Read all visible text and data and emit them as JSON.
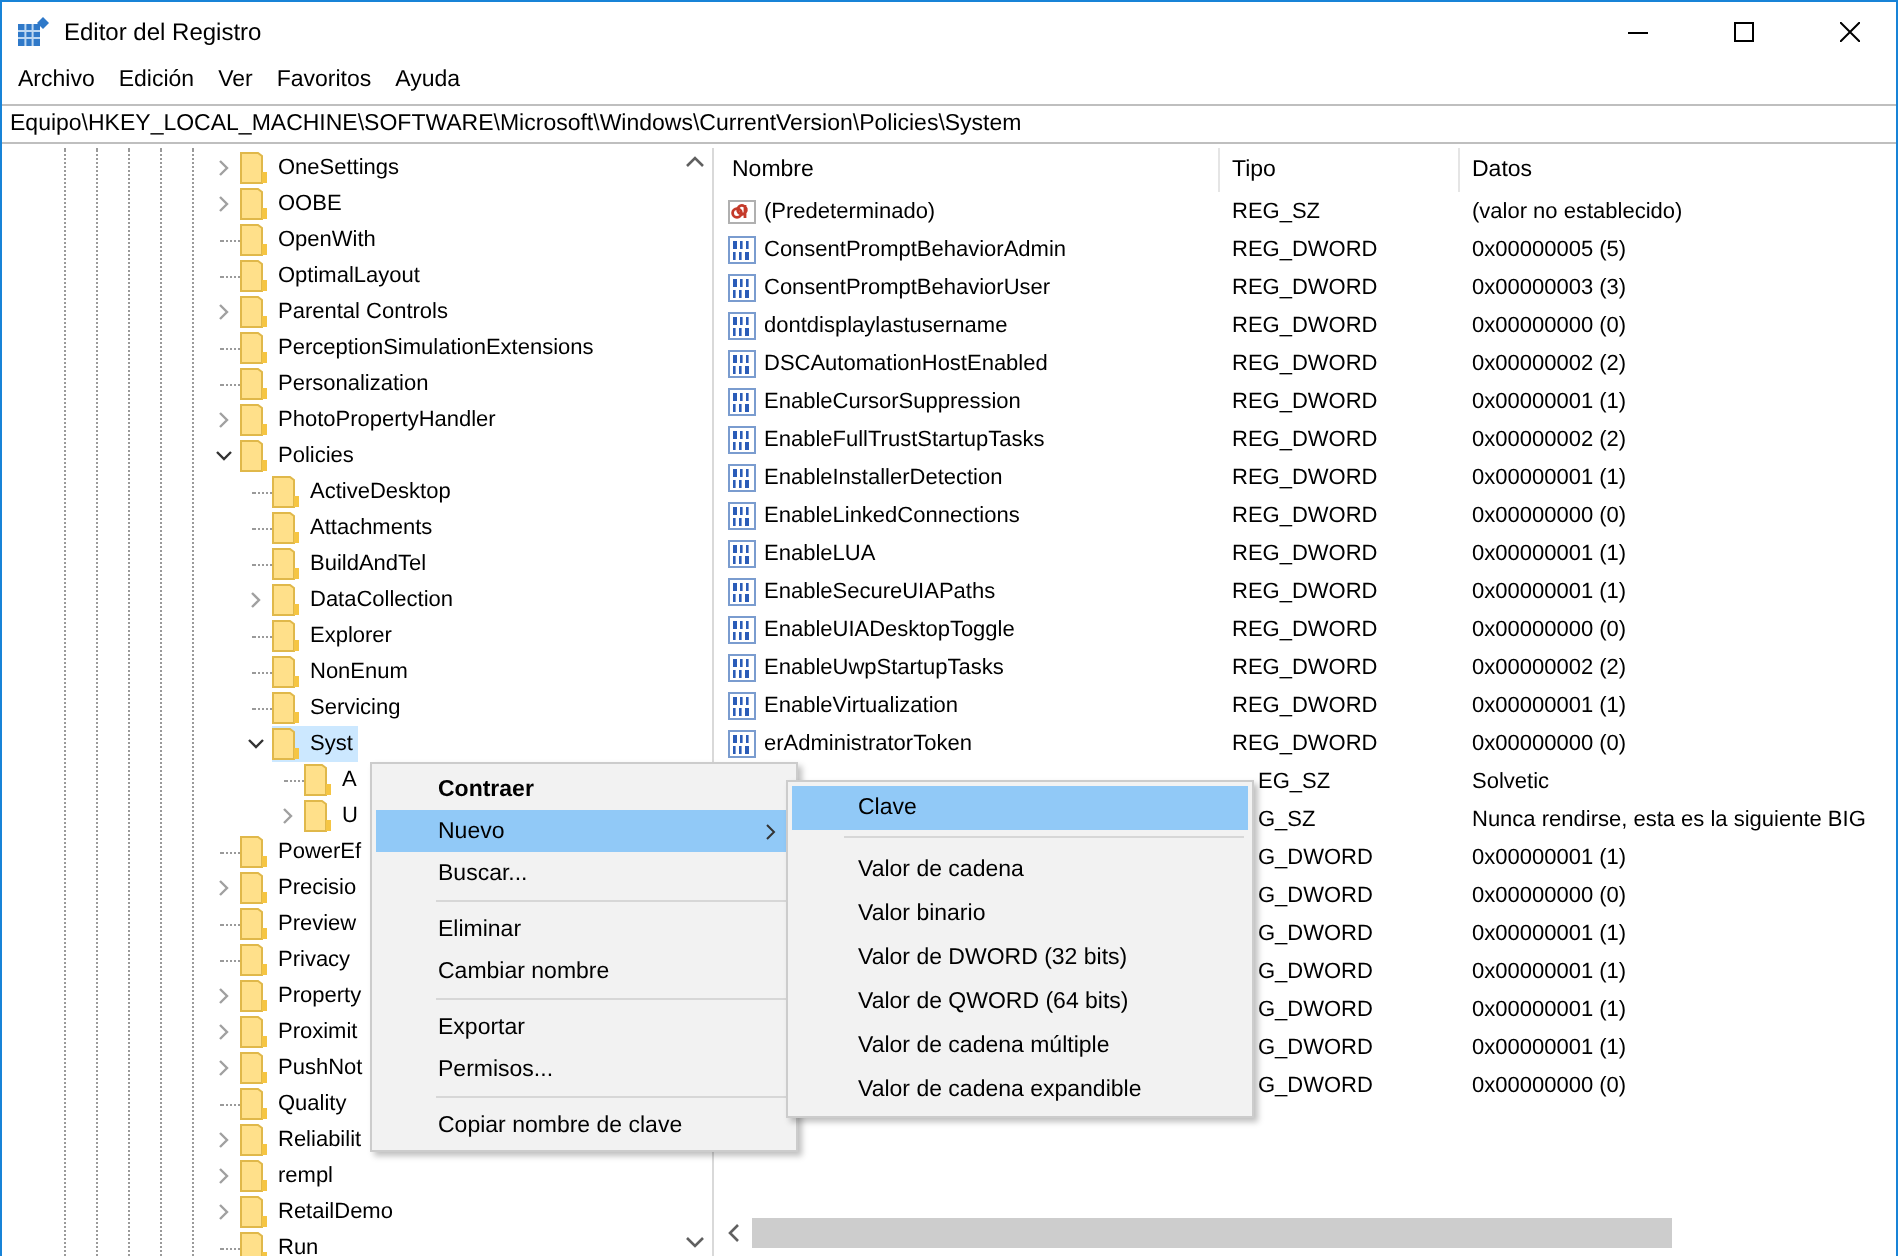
{
  "window": {
    "title": "Editor del Registro"
  },
  "menu_bar": [
    "Archivo",
    "Edición",
    "Ver",
    "Favoritos",
    "Ayuda"
  ],
  "address": "Equipo\\HKEY_LOCAL_MACHINE\\SOFTWARE\\Microsoft\\Windows\\CurrentVersion\\Policies\\System",
  "tree": [
    {
      "label": "OneSettings",
      "kind": "branch",
      "expanded": false,
      "selected": false
    },
    {
      "label": "OOBE",
      "kind": "branch",
      "expanded": false,
      "selected": false
    },
    {
      "label": "OpenWith",
      "kind": "leaf",
      "selected": false
    },
    {
      "label": "OptimalLayout",
      "kind": "leaf",
      "selected": false
    },
    {
      "label": "Parental Controls",
      "kind": "branch",
      "expanded": false,
      "selected": false
    },
    {
      "label": "PerceptionSimulationExtensions",
      "kind": "leaf",
      "selected": false
    },
    {
      "label": "Personalization",
      "kind": "leaf",
      "selected": false
    },
    {
      "label": "PhotoPropertyHandler",
      "kind": "branch",
      "expanded": false,
      "selected": false
    },
    {
      "label": "Policies",
      "kind": "branch",
      "expanded": true,
      "selected": false,
      "children": [
        {
          "label": "ActiveDesktop",
          "kind": "leaf",
          "selected": false
        },
        {
          "label": "Attachments",
          "kind": "leaf",
          "selected": false
        },
        {
          "label": "BuildAndTel",
          "kind": "leaf",
          "selected": false
        },
        {
          "label": "DataCollection",
          "kind": "branch",
          "expanded": false,
          "selected": false
        },
        {
          "label": "Explorer",
          "kind": "leaf",
          "selected": false
        },
        {
          "label": "NonEnum",
          "kind": "leaf",
          "selected": false
        },
        {
          "label": "Servicing",
          "kind": "leaf",
          "selected": false
        },
        {
          "label": "Syst",
          "kind": "branch",
          "expanded": true,
          "selected": true,
          "children": [
            {
              "label": "A",
              "kind": "leaf",
              "selected": false
            },
            {
              "label": "U",
              "kind": "branch",
              "expanded": false,
              "selected": false
            }
          ]
        }
      ]
    },
    {
      "label": "PowerEf",
      "kind": "leaf",
      "selected": false
    },
    {
      "label": "Precisio",
      "kind": "branch",
      "expanded": false,
      "selected": false
    },
    {
      "label": "Preview",
      "kind": "leaf",
      "selected": false
    },
    {
      "label": "Privacy",
      "kind": "leaf",
      "selected": false
    },
    {
      "label": "Property",
      "kind": "branch",
      "expanded": false,
      "selected": false
    },
    {
      "label": "Proximit",
      "kind": "branch",
      "expanded": false,
      "selected": false
    },
    {
      "label": "PushNot",
      "kind": "branch",
      "expanded": false,
      "selected": false
    },
    {
      "label": "Quality",
      "kind": "leaf",
      "selected": false
    },
    {
      "label": "Reliabilit",
      "kind": "branch",
      "expanded": false,
      "selected": false
    },
    {
      "label": "rempl",
      "kind": "branch",
      "expanded": false,
      "selected": false
    },
    {
      "label": "RetailDemo",
      "kind": "branch",
      "expanded": false,
      "selected": false
    },
    {
      "label": "Run",
      "kind": "leaf",
      "selected": false
    }
  ],
  "table": {
    "columns": [
      "Nombre",
      "Tipo",
      "Datos"
    ],
    "rows": [
      {
        "kind": "string",
        "name": "(Predeterminado)",
        "type": "REG_SZ",
        "data": "(valor no establecido)"
      },
      {
        "kind": "dword",
        "name": "ConsentPromptBehaviorAdmin",
        "type": "REG_DWORD",
        "data": "0x00000005 (5)"
      },
      {
        "kind": "dword",
        "name": "ConsentPromptBehaviorUser",
        "type": "REG_DWORD",
        "data": "0x00000003 (3)"
      },
      {
        "kind": "dword",
        "name": "dontdisplaylastusername",
        "type": "REG_DWORD",
        "data": "0x00000000 (0)"
      },
      {
        "kind": "dword",
        "name": "DSCAutomationHostEnabled",
        "type": "REG_DWORD",
        "data": "0x00000002 (2)"
      },
      {
        "kind": "dword",
        "name": "EnableCursorSuppression",
        "type": "REG_DWORD",
        "data": "0x00000001 (1)"
      },
      {
        "kind": "dword",
        "name": "EnableFullTrustStartupTasks",
        "type": "REG_DWORD",
        "data": "0x00000002 (2)"
      },
      {
        "kind": "dword",
        "name": "EnableInstallerDetection",
        "type": "REG_DWORD",
        "data": "0x00000001 (1)"
      },
      {
        "kind": "dword",
        "name": "EnableLinkedConnections",
        "type": "REG_DWORD",
        "data": "0x00000000 (0)"
      },
      {
        "kind": "dword",
        "name": "EnableLUA",
        "type": "REG_DWORD",
        "data": "0x00000001 (1)"
      },
      {
        "kind": "dword",
        "name": "EnableSecureUIAPaths",
        "type": "REG_DWORD",
        "data": "0x00000001 (1)"
      },
      {
        "kind": "dword",
        "name": "EnableUIADesktopToggle",
        "type": "REG_DWORD",
        "data": "0x00000000 (0)"
      },
      {
        "kind": "dword",
        "name": "EnableUwpStartupTasks",
        "type": "REG_DWORD",
        "data": "0x00000002 (2)"
      },
      {
        "kind": "dword",
        "name": "EnableVirtualization",
        "type": "REG_DWORD",
        "data": "0x00000001 (1)"
      },
      {
        "kind": "dword",
        "name": "erAdministratorToken",
        "type": "REG_DWORD",
        "data": "0x00000000 (0)"
      },
      {
        "type": "EG_SZ",
        "data": "Solvetic"
      },
      {
        "type": "G_SZ",
        "data": "Nunca rendirse, esta es la siguiente BIG"
      },
      {
        "type": "G_DWORD",
        "data": "0x00000001 (1)"
      },
      {
        "type": "G_DWORD",
        "data": "0x00000000 (0)"
      },
      {
        "type": "G_DWORD",
        "data": "0x00000001 (1)"
      },
      {
        "type": "G_DWORD",
        "data": "0x00000001 (1)"
      },
      {
        "type": "G_DWORD",
        "data": "0x00000001 (1)"
      },
      {
        "type": "G_DWORD",
        "data": "0x00000001 (1)"
      },
      {
        "type": "G_DWORD",
        "data": "0x00000000 (0)"
      }
    ]
  },
  "context_menu": [
    {
      "kind": "item",
      "label": "Contraer",
      "default": true,
      "submenu": false,
      "selected": false
    },
    {
      "kind": "item",
      "label": "Nuevo",
      "default": false,
      "submenu": true,
      "selected": true
    },
    {
      "kind": "item",
      "label": "Buscar...",
      "default": false,
      "submenu": false,
      "selected": false
    },
    {
      "kind": "separator"
    },
    {
      "kind": "item",
      "label": "Eliminar",
      "default": false,
      "submenu": false,
      "selected": false
    },
    {
      "kind": "item",
      "label": "Cambiar nombre",
      "default": false,
      "submenu": false,
      "selected": false
    },
    {
      "kind": "separator"
    },
    {
      "kind": "item",
      "label": "Exportar",
      "default": false,
      "submenu": false,
      "selected": false
    },
    {
      "kind": "item",
      "label": "Permisos...",
      "default": false,
      "submenu": false,
      "selected": false
    },
    {
      "kind": "separator"
    },
    {
      "kind": "item",
      "label": "Copiar nombre de clave",
      "default": false,
      "submenu": false,
      "selected": false
    }
  ],
  "submenu": [
    {
      "kind": "item",
      "label": "Clave",
      "selected": true
    },
    {
      "kind": "separator"
    },
    {
      "kind": "item",
      "label": "Valor de cadena",
      "selected": false
    },
    {
      "kind": "item",
      "label": "Valor binario",
      "selected": false
    },
    {
      "kind": "item",
      "label": "Valor de DWORD (32 bits)",
      "selected": false
    },
    {
      "kind": "item",
      "label": "Valor de QWORD (64 bits)",
      "selected": false
    },
    {
      "kind": "item",
      "label": "Valor de cadena múltiple",
      "selected": false
    },
    {
      "kind": "item",
      "label": "Valor de cadena expandible",
      "selected": false
    }
  ]
}
